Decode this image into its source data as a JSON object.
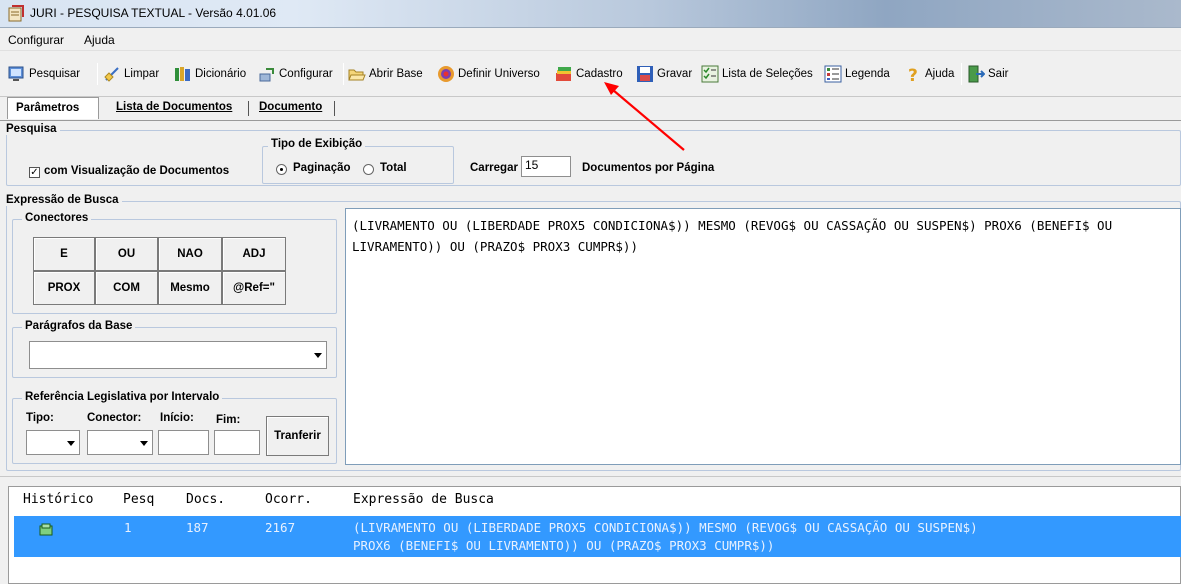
{
  "window": {
    "title": "JURI - PESQUISA TEXTUAL - Versão 4.01.06"
  },
  "menu": [
    "Configurar",
    "Ajuda"
  ],
  "toolbar": {
    "pesquisar": "Pesquisar",
    "limpar": "Limpar",
    "dicionario": "Dicionário",
    "configurar": "Configurar",
    "abrir_base": "Abrir Base",
    "definir_universo": "Definir Universo",
    "cadastro": "Cadastro",
    "gravar": "Gravar",
    "lista_selecoes": "Lista de Seleções",
    "legenda": "Legenda",
    "ajuda": "Ajuda",
    "sair": "Sair"
  },
  "tabs": [
    "Parâmetros",
    "Lista de Documentos",
    "Documento"
  ],
  "pesquisa": {
    "group_title": "Pesquisa",
    "visualizacao_label": "com Visualização de Documentos",
    "visualizacao_checked": true
  },
  "tipo_exibicao": {
    "group_title": "Tipo de Exibição",
    "paginacao": "Paginação",
    "total": "Total",
    "selected": "Paginação"
  },
  "carregar": {
    "label": "Carregar",
    "value": "15",
    "suffix": "Documentos por Página"
  },
  "expressao": {
    "group_title": "Expressão de Busca",
    "text": "(LIVRAMENTO OU (LIBERDADE PROX5 CONDICIONA$)) MESMO (REVOG$ OU CASSAÇÃO OU SUSPEN$) PROX6 (BENEFI$ OU LIVRAMENTO)) OU (PRAZO$ PROX3 CUMPR$))"
  },
  "conectores": {
    "group_title": "Conectores",
    "buttons": [
      "E",
      "OU",
      "NAO",
      "ADJ",
      "PROX",
      "COM",
      "Mesmo",
      "@Ref=\""
    ]
  },
  "paragrafos": {
    "group_title": "Parágrafos da Base",
    "value": ""
  },
  "referencia": {
    "group_title": "Referência Legislativa por Intervalo",
    "tipo": "Tipo:",
    "conector": "Conector:",
    "inicio": "Início:",
    "fim": "Fim:",
    "transferir": "Tranferir"
  },
  "historico": {
    "columns": [
      "Histórico",
      "Pesq",
      "Docs.",
      "Ocorr.",
      "Expressão de Busca"
    ],
    "rows": [
      {
        "pesq": "1",
        "docs": "187",
        "ocorr": "2167",
        "expr_line1": "(LIVRAMENTO OU (LIBERDADE PROX5 CONDICIONA$)) MESMO (REVOG$ OU CASSAÇÃO OU SUSPEN$)",
        "expr_line2": "PROX6 (BENEFI$ OU LIVRAMENTO)) OU (PRAZO$ PROX3 CUMPR$))"
      }
    ]
  },
  "colors": {
    "selection": "#3399ff",
    "annotation_arrow": "#ff0000",
    "group_border": "#b9c8de"
  }
}
